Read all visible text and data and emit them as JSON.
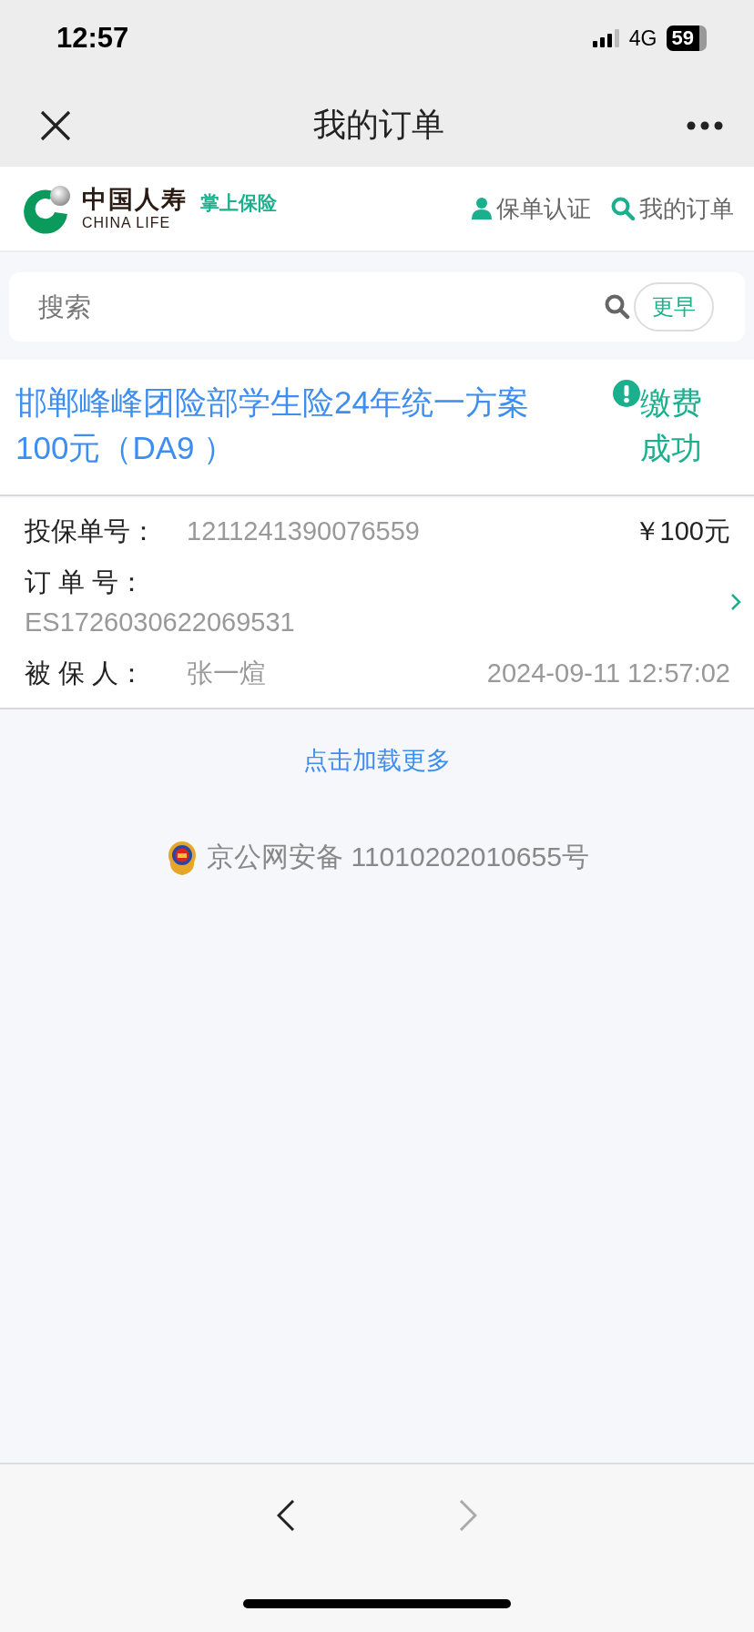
{
  "status_bar": {
    "time": "12:57",
    "network": "4G",
    "battery": "59"
  },
  "nav_bar": {
    "title": "我的订单"
  },
  "brand_header": {
    "logo_cn": "中国人寿",
    "logo_en": "CHINA LIFE",
    "slogan": "掌上保险",
    "links": [
      {
        "kind": "person",
        "label": "保单认证"
      },
      {
        "kind": "search",
        "label": "我的订单"
      }
    ]
  },
  "search": {
    "placeholder": "搜索",
    "button": "更早"
  },
  "orders": [
    {
      "title": "邯郸峰峰团险部学生险24年统一方案100元（DA9 ）",
      "status": "缴费成功",
      "policy_label": "投保单号：",
      "policy_no": "1211241390076559",
      "amount": "￥100元",
      "order_label": "订 单 号：",
      "order_no": "ES1726030622069531",
      "insured_label": "被 保 人：",
      "insured": "张一煊",
      "time": "2024-09-11 12:57:02"
    }
  ],
  "load_more": "点击加载更多",
  "icp": "京公网安备 11010202010655号",
  "toolbar": {
    "back_enabled": true,
    "forward_enabled": false
  }
}
